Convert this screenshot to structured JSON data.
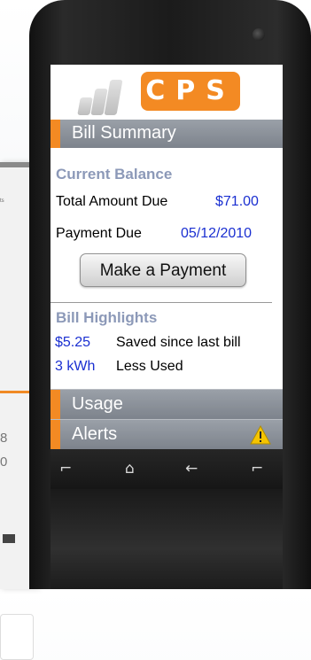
{
  "background_window": {
    "values": [
      "8",
      "0"
    ]
  },
  "app": {
    "logo_text": "CPS",
    "brand_color": "#f38a23",
    "link_color": "#1a2fd1",
    "section_title": "Bill Summary"
  },
  "balance": {
    "heading": "Current Balance",
    "total_label": "Total Amount Due",
    "total_value": "$71.00",
    "due_label": "Payment Due",
    "due_value": "05/12/2010",
    "pay_button": "Make a Payment"
  },
  "highlights": {
    "heading": "Bill Highlights",
    "items": [
      {
        "value": "$5.25",
        "text": "Saved since last bill"
      },
      {
        "value": "3 kWh",
        "text": "Less Used"
      }
    ]
  },
  "menu": {
    "items": [
      {
        "label": "Usage",
        "icon": "none"
      },
      {
        "label": "Alerts",
        "icon": "warning-icon"
      }
    ]
  },
  "nav_keys": [
    {
      "name": "call-key",
      "glyph": "⌐"
    },
    {
      "name": "home-key",
      "glyph": "⌂"
    },
    {
      "name": "back-key",
      "glyph": "←"
    },
    {
      "name": "end-key",
      "glyph": "⌐"
    }
  ]
}
